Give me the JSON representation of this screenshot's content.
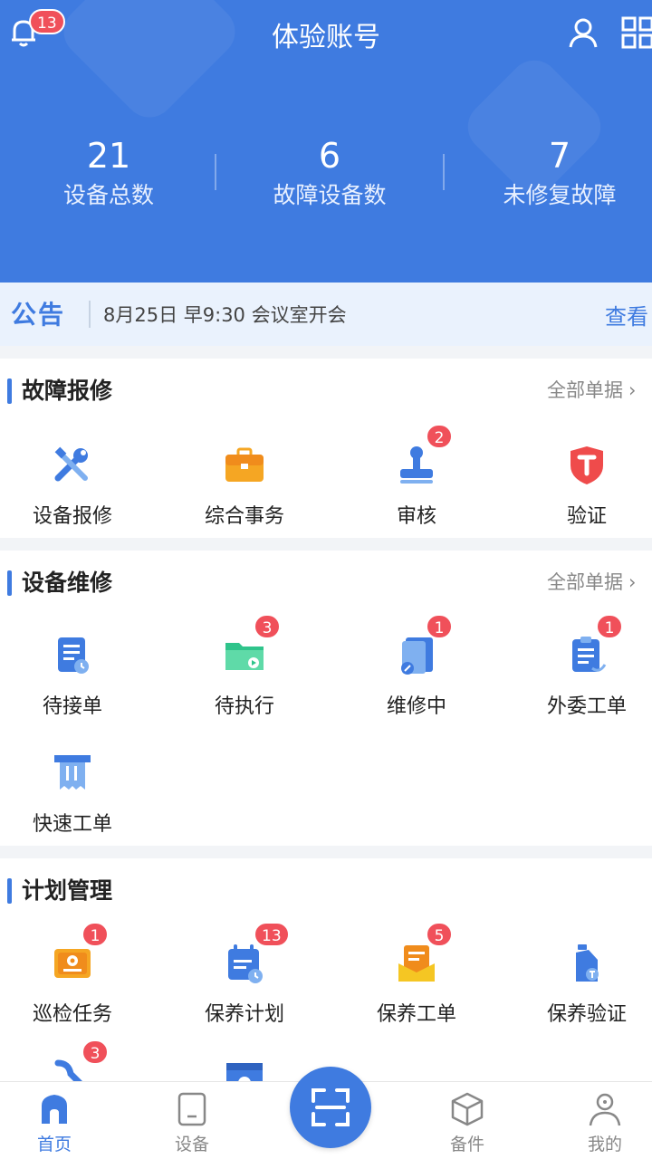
{
  "header": {
    "title": "体验账号",
    "bell_badge": "13",
    "stats": [
      {
        "value": "21",
        "label": "设备总数"
      },
      {
        "value": "6",
        "label": "故障设备数"
      },
      {
        "value": "7",
        "label": "未修复故障"
      }
    ],
    "colors": {
      "primary": "#3f7be0",
      "badge": "#f0505a"
    }
  },
  "notice": {
    "tag": "公告",
    "text": "8月25日 早9:30 会议室开会",
    "link": "查看"
  },
  "sections": [
    {
      "title": "故障报修",
      "more": "全部单据",
      "items": [
        {
          "label": "设备报修",
          "icon": "tools-icon",
          "badge": ""
        },
        {
          "label": "综合事务",
          "icon": "briefcase-icon",
          "badge": ""
        },
        {
          "label": "审核",
          "icon": "stamp-icon",
          "badge": "2"
        },
        {
          "label": "验证",
          "icon": "shield-icon",
          "badge": ""
        }
      ]
    },
    {
      "title": "设备维修",
      "more": "全部单据",
      "items": [
        {
          "label": "待接单",
          "icon": "clipboard-clock-icon",
          "badge": ""
        },
        {
          "label": "待执行",
          "icon": "folder-play-icon",
          "badge": "3"
        },
        {
          "label": "维修中",
          "icon": "book-wrench-icon",
          "badge": "1"
        },
        {
          "label": "外委工单",
          "icon": "clipboard-list-icon",
          "badge": "1"
        },
        {
          "label": "快速工单",
          "icon": "receipt-icon",
          "badge": ""
        }
      ]
    },
    {
      "title": "计划管理",
      "items": [
        {
          "label": "巡检任务",
          "icon": "location-card-icon",
          "badge": "1"
        },
        {
          "label": "保养计划",
          "icon": "calendar-icon",
          "badge": "13"
        },
        {
          "label": "保养工单",
          "icon": "mail-doc-icon",
          "badge": "5"
        },
        {
          "label": "保养验证",
          "icon": "oil-bottle-icon",
          "badge": ""
        },
        {
          "label": "",
          "icon": "wrench-icon",
          "badge": "3"
        },
        {
          "label": "",
          "icon": "window-icon",
          "badge": ""
        }
      ]
    }
  ],
  "nav": [
    {
      "label": "首页",
      "icon": "home-icon"
    },
    {
      "label": "设备",
      "icon": "tablet-icon"
    },
    {
      "label": "",
      "icon": "scan-icon"
    },
    {
      "label": "备件",
      "icon": "box-icon"
    },
    {
      "label": "我的",
      "icon": "person-icon"
    }
  ]
}
